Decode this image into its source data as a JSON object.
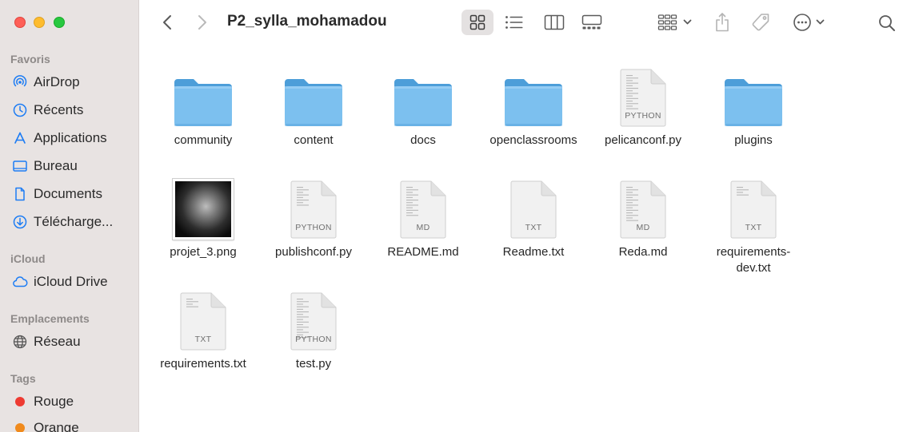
{
  "window": {
    "title": "P2_sylla_mohamadou"
  },
  "sidebar": {
    "sections": [
      {
        "title": "Favoris",
        "items": [
          {
            "label": "AirDrop",
            "icon": "airdrop-icon"
          },
          {
            "label": "Récents",
            "icon": "clock-icon"
          },
          {
            "label": "Applications",
            "icon": "applications-icon"
          },
          {
            "label": "Bureau",
            "icon": "desktop-icon"
          },
          {
            "label": "Documents",
            "icon": "document-icon"
          },
          {
            "label": "Télécharge...",
            "icon": "download-icon"
          }
        ]
      },
      {
        "title": "iCloud",
        "items": [
          {
            "label": "iCloud Drive",
            "icon": "cloud-icon"
          }
        ]
      },
      {
        "title": "Emplacements",
        "items": [
          {
            "label": "Réseau",
            "icon": "globe-icon"
          }
        ]
      },
      {
        "title": "Tags",
        "items": [
          {
            "label": "Rouge",
            "color": "#ee3b32"
          },
          {
            "label": "Orange",
            "color": "#f08a1c"
          }
        ]
      }
    ]
  },
  "toolbar": {
    "back_icon": "chevron-left-icon",
    "forward_icon": "chevron-right-icon",
    "view_modes": [
      "icon-view-icon",
      "list-view-icon",
      "column-view-icon",
      "gallery-view-icon"
    ],
    "active_view": "icon-view-icon",
    "actions": [
      "group-icon",
      "share-icon",
      "tag-icon",
      "more-icon",
      "search-icon"
    ]
  },
  "files": [
    {
      "name": "community",
      "kind": "folder"
    },
    {
      "name": "content",
      "kind": "folder"
    },
    {
      "name": "docs",
      "kind": "folder"
    },
    {
      "name": "openclassrooms",
      "kind": "folder"
    },
    {
      "name": "pelicanconf.py",
      "kind": "document",
      "ext": "PYTHON"
    },
    {
      "name": "plugins",
      "kind": "folder"
    },
    {
      "name": "projet_3.png",
      "kind": "image"
    },
    {
      "name": "publishconf.py",
      "kind": "document",
      "ext": "PYTHON"
    },
    {
      "name": "README.md",
      "kind": "document",
      "ext": "MD"
    },
    {
      "name": "Readme.txt",
      "kind": "document",
      "ext": "TXT"
    },
    {
      "name": "Reda.md",
      "kind": "document",
      "ext": "MD"
    },
    {
      "name": "requirements-dev.txt",
      "kind": "document",
      "ext": "TXT",
      "label_lines": [
        "requirements-",
        "dev.txt"
      ]
    },
    {
      "name": "requirements.txt",
      "kind": "document",
      "ext": "TXT"
    },
    {
      "name": "test.py",
      "kind": "document",
      "ext": "PYTHON"
    }
  ],
  "colors": {
    "sidebar_bg": "#e8e3e2",
    "accent": "#1c7cf4",
    "folder": "#7cc0ef"
  }
}
